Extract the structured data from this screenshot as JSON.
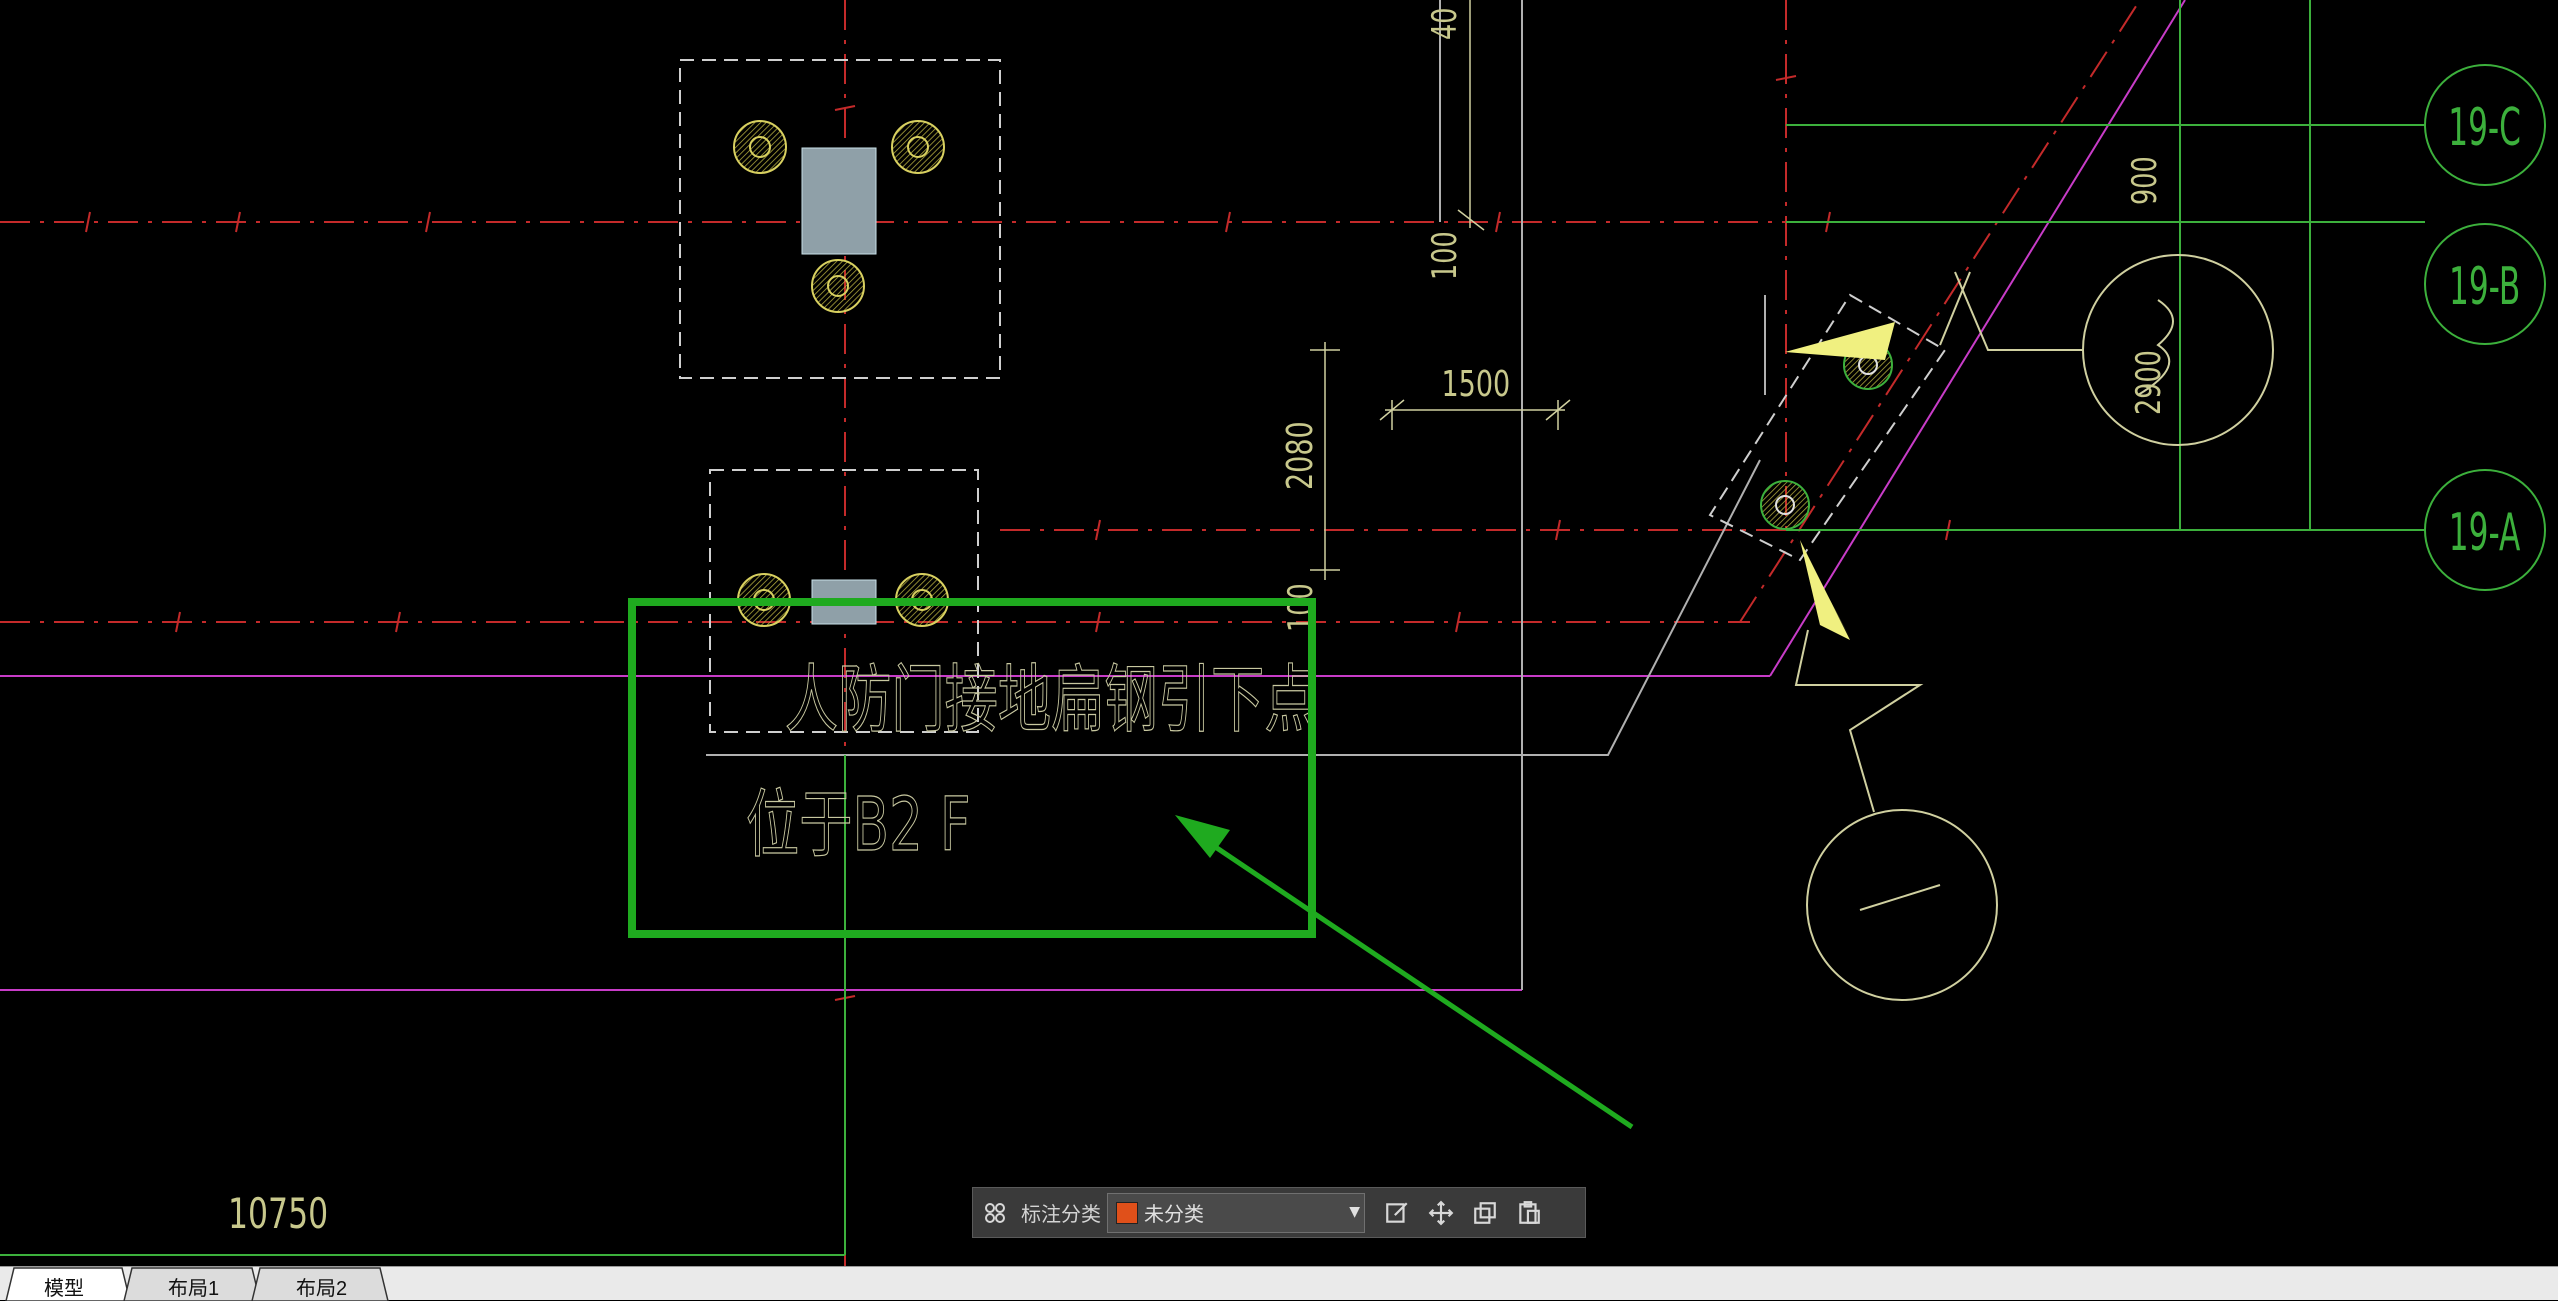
{
  "drawing": {
    "annotation_text_line1": "人防门接地扁钢引下点",
    "annotation_text_line2": "位于B2 F",
    "dim_1500": "1500",
    "dim_2080": "2080",
    "dim_100_top": "100",
    "dim_100_left": "100",
    "dim_40": "40",
    "dim_900": "900",
    "dim_2900": "2900",
    "dim_10750": "10750",
    "axis_19c": "19-C",
    "axis_19b": "19-B",
    "axis_19a": "19-A"
  },
  "toolbar": {
    "label": "标注分类",
    "category_value": "未分类",
    "category_color": "#e0501a"
  },
  "tabs": [
    {
      "label": "模型"
    },
    {
      "label": "布局1"
    },
    {
      "label": "布局2"
    }
  ],
  "colors": {
    "axis_red": "#c42a2a",
    "magenta": "#c83cc8",
    "green_grid": "#3cb03c",
    "yellow_text": "#c8c88c",
    "highlight_green": "#1faa1f"
  }
}
